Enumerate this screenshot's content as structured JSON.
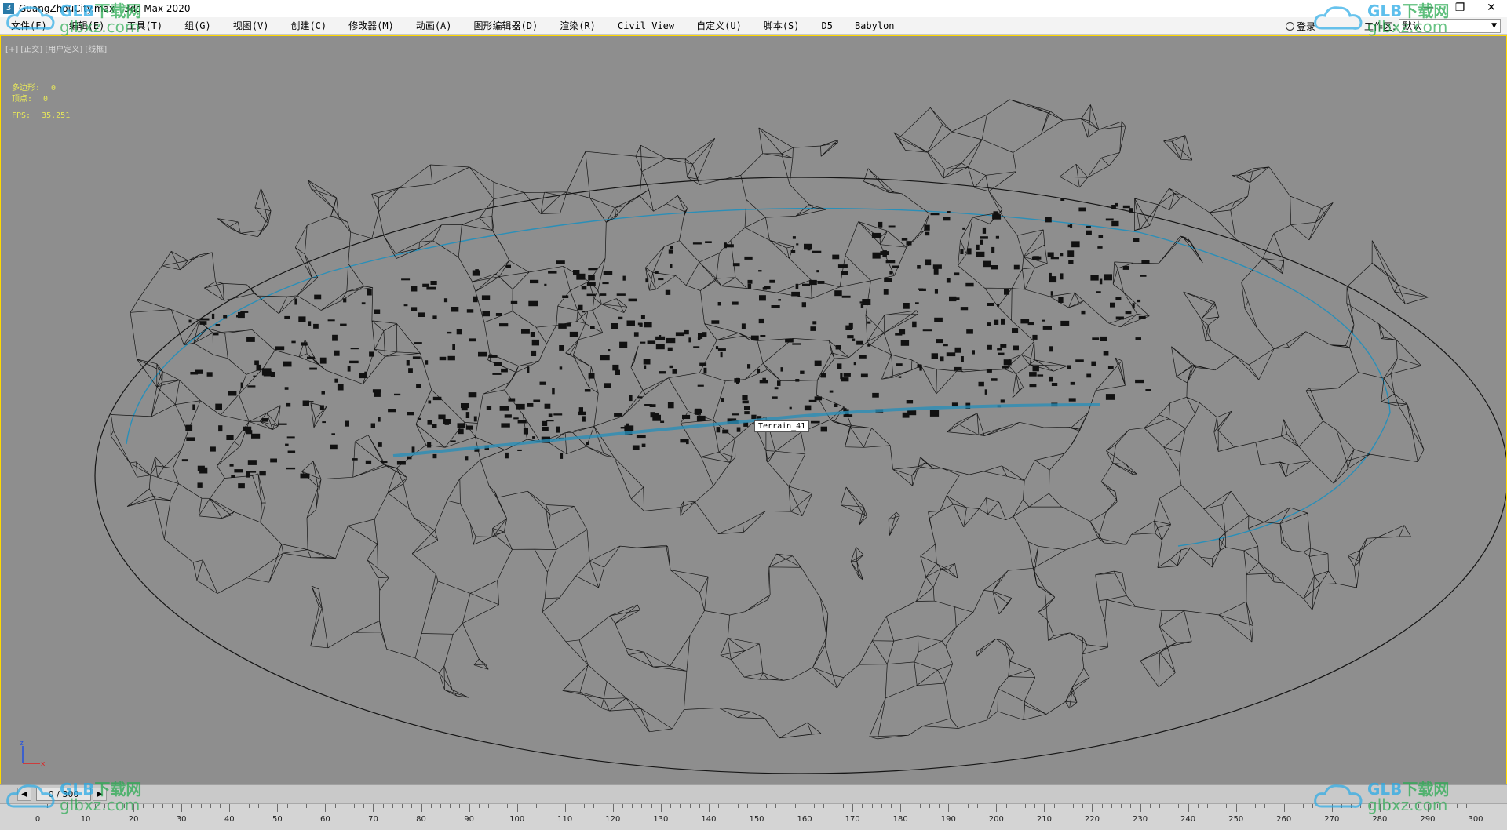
{
  "titlebar": {
    "title": "GuangZhouCity.max - 3ds Max 2020",
    "minimize": "—",
    "restore": "❐",
    "close": "✕"
  },
  "menubar": {
    "items": [
      "文件(F)",
      "编辑(E)",
      "工具(T)",
      "组(G)",
      "视图(V)",
      "创建(C)",
      "修改器(M)",
      "动画(A)",
      "图形编辑器(D)",
      "渲染(R)",
      "Civil View",
      "自定义(U)",
      "脚本(S)",
      "D5",
      "Babylon"
    ],
    "login_label": "登录",
    "workspace_label": "工作区:",
    "workspace_value": "默认"
  },
  "viewport": {
    "label": "[+] [正交] [用户定义] [线框]",
    "stats": {
      "polygons_label": "多边形:",
      "polygons_value": "0",
      "vertices_label": "顶点:",
      "vertices_value": "0",
      "fps_label": "FPS:",
      "fps_value": "35.251"
    },
    "tooltip": "Terrain_41",
    "axis": {
      "z": "z",
      "x": "x"
    }
  },
  "timeline": {
    "slider_text": "0 / 300",
    "ticks": [
      "0",
      "10",
      "20",
      "30",
      "40",
      "50",
      "60",
      "70",
      "80",
      "90",
      "100",
      "110",
      "120",
      "130",
      "140",
      "150",
      "160",
      "170",
      "180",
      "190",
      "200",
      "210",
      "220",
      "230",
      "240",
      "250",
      "260",
      "270",
      "280",
      "290",
      "300"
    ]
  },
  "watermarks": {
    "brand": "GLB",
    "brand_cn": "下载网",
    "site": "glbxz.com"
  },
  "colors": {
    "viewport_bg": "#8e8e8e",
    "wire": "#151515",
    "water": "#2a8fb8",
    "stats": "#e8e85a",
    "active_border": "#ffd900"
  }
}
